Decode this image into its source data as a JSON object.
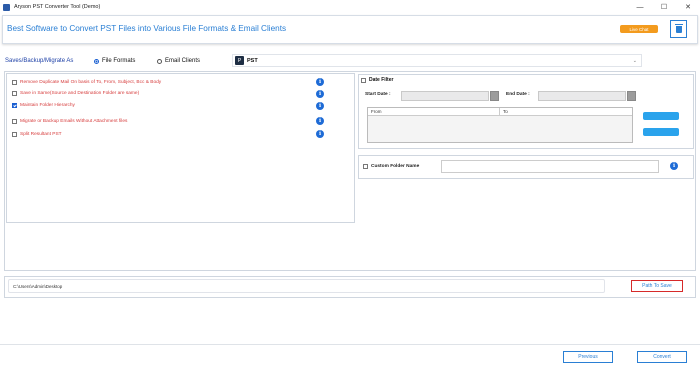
{
  "window": {
    "title": "Aryson PST Converter Tool (Demo)",
    "controls": [
      "—",
      "☐",
      "✕"
    ]
  },
  "header": {
    "title": "Best Software to Convert PST Files into Various File Formats & Email Clients",
    "live_chat": "Live Chat",
    "accent": "#2a7fd4",
    "live_chat_color": "#f39b1e"
  },
  "save_row": {
    "label": "Saves/Backup/Migrate As",
    "options": [
      {
        "label": "File Formats",
        "selected": true
      },
      {
        "label": "Email Clients",
        "selected": false
      }
    ],
    "format_icon": "P",
    "format_value": "PST"
  },
  "options": [
    {
      "label": "Remove Duplicate Mail On basis of To, From, Subject, Bcc & Body",
      "checked": false
    },
    {
      "label": "Save in Same(Source and Destination Folder are same)",
      "checked": false
    },
    {
      "label": "Maintain Folder Hierarchy",
      "checked": true
    },
    {
      "label": "Migrate or Backup Emails Without Attachment files",
      "checked": false
    },
    {
      "label": "Split Resultant PST",
      "checked": false
    }
  ],
  "info_glyph": "i",
  "date_filter": {
    "label": "Date Filter",
    "checked": false,
    "start_label": "Start Date :",
    "end_label": "End Date :",
    "columns": [
      "From",
      "To"
    ]
  },
  "custom_folder": {
    "label": "Custom Folder Name",
    "checked": false
  },
  "path": {
    "value": "C:\\Users\\Admin\\Desktop",
    "button": "Path To Save"
  },
  "footer": {
    "previous": "Previous",
    "convert": "Convert"
  }
}
